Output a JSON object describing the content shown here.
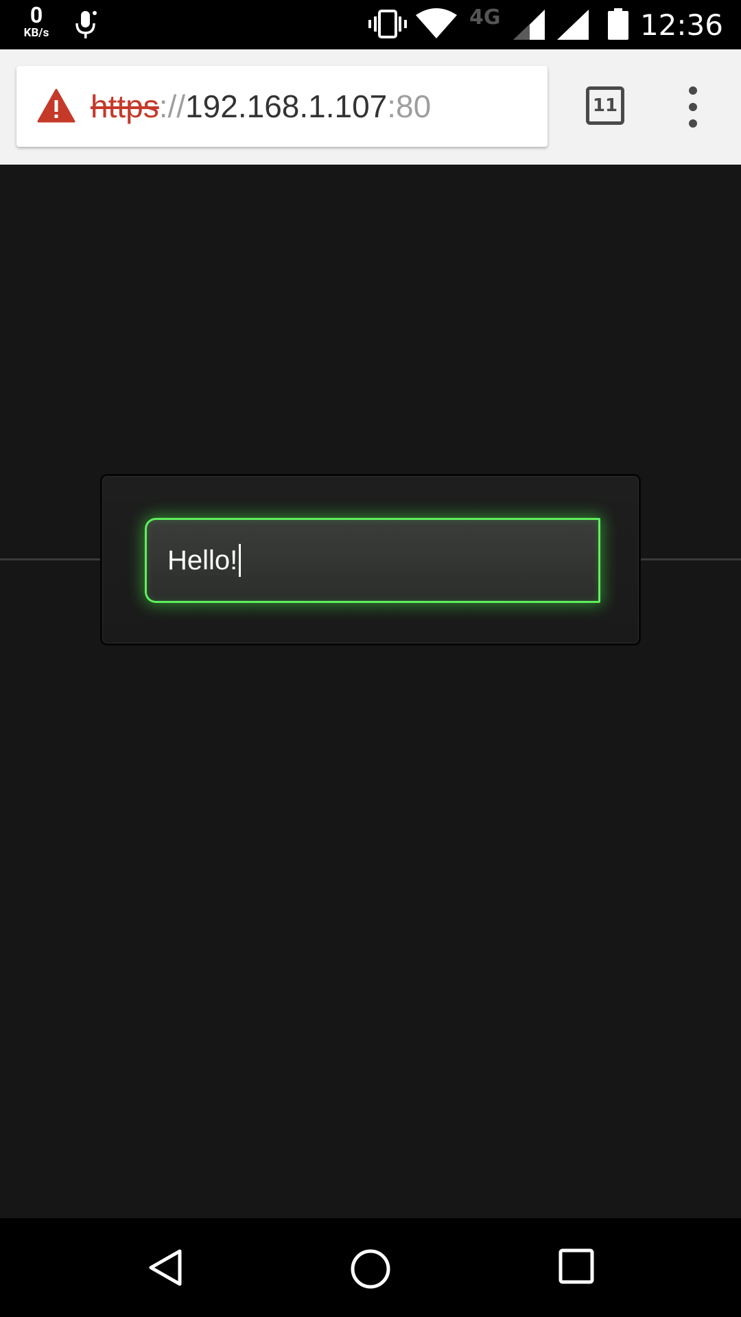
{
  "status_bar": {
    "net_speed_value": "0",
    "net_speed_unit": "KB/s",
    "network_type": "4G",
    "time": "12:36",
    "icons": [
      "mic-icon",
      "vibrate-icon",
      "wifi-icon",
      "signal-icon",
      "battery-icon"
    ]
  },
  "browser": {
    "url_scheme": "https",
    "url_separator": "://",
    "url_host": "192.168.1.107",
    "url_port": ":80",
    "tab_count": "11",
    "security_state": "not-secure",
    "colors": {
      "warning": "#c53929",
      "toolbar_bg": "#f2f2f2"
    }
  },
  "page": {
    "text_field_value": "Hello!",
    "colors": {
      "background": "#161616",
      "field_glow": "#5ef05e"
    }
  },
  "nav_bar": {
    "icons": [
      "back-icon",
      "home-icon",
      "recents-icon"
    ]
  }
}
